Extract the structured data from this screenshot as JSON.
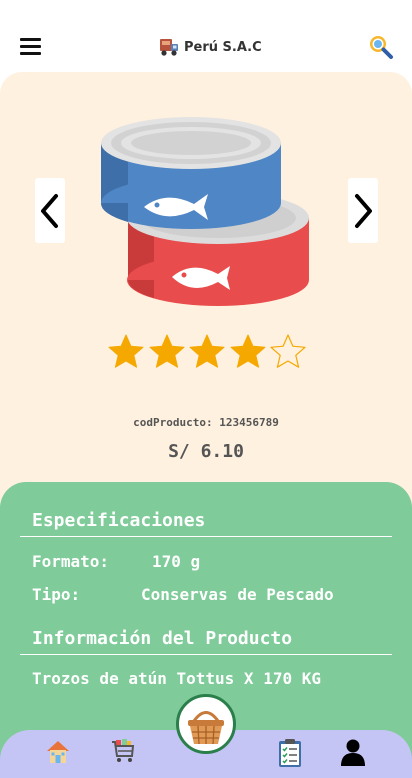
{
  "header": {
    "brand_title": "Perú S.A.C"
  },
  "product": {
    "rating": 4,
    "rating_max": 5,
    "code_label": "codProducto:",
    "code_value": "123456789",
    "price": "S/ 6.10"
  },
  "specs": {
    "title": "Especificaciones",
    "format_label": "Formato:",
    "format_value": "170 g",
    "type_label": "Tipo:",
    "type_value": "Conservas de Pescado"
  },
  "info": {
    "title": "Información del Producto",
    "description": "Trozos de atún Tottus X 170 KG"
  },
  "colors": {
    "card_bg": "#fff1e0",
    "details_bg": "#7fcb9a",
    "bottom_nav_bg": "#c5c5f5",
    "star_fill": "#f5a800",
    "can_blue": "#4f86c6",
    "can_red": "#e84c4c"
  },
  "icons": {
    "menu": "hamburger-icon",
    "brand": "delivery-truck-icon",
    "search": "search-icon",
    "prev": "chevron-left-icon",
    "next": "chevron-right-icon",
    "home": "home-icon",
    "cart": "shopping-cart-icon",
    "basket": "basket-icon",
    "orders": "clipboard-list-icon",
    "profile": "user-icon"
  }
}
